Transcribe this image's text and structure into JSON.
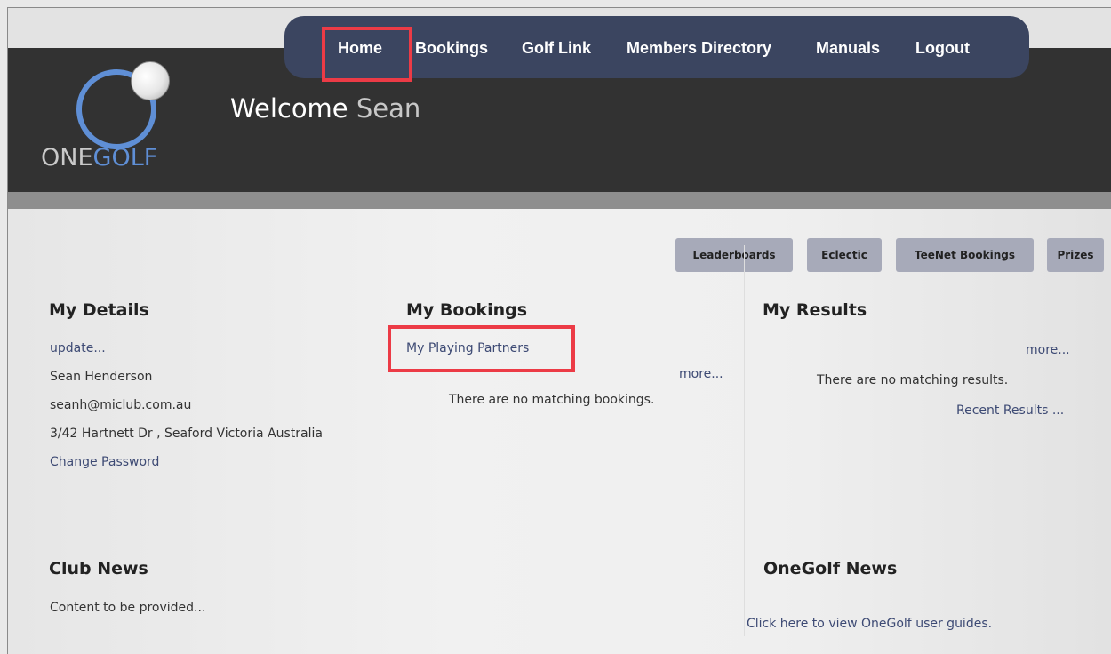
{
  "nav": {
    "items": [
      "Home",
      "Bookings",
      "Golf Link",
      "Members Directory",
      "Manuals",
      "Logout"
    ]
  },
  "logo": {
    "one": "ONE",
    "golf": "GOLF"
  },
  "welcome": {
    "greeting": "Welcome",
    "name": "Sean"
  },
  "action_buttons": [
    "Leaderboards",
    "Eclectic",
    "TeeNet Bookings",
    "Prizes"
  ],
  "my_details": {
    "heading": "My Details",
    "update_link": "update...",
    "name": "Sean Henderson",
    "email": "seanh@miclub.com.au",
    "address": "3/42 Hartnett Dr , Seaford Victoria Australia",
    "change_password": "Change Password"
  },
  "my_bookings": {
    "heading": "My Bookings",
    "playing_partners": "My Playing Partners",
    "more": "more...",
    "empty": "There are no matching bookings."
  },
  "my_results": {
    "heading": "My Results",
    "more": "more...",
    "empty": "There are no matching results.",
    "recent": "Recent Results ..."
  },
  "club_news": {
    "heading": "Club News",
    "content": "Content to be provided..."
  },
  "onegolf_news": {
    "heading": "OneGolf News",
    "guides": "Click here to view OneGolf user guides."
  },
  "colors": {
    "header": "#323232",
    "nav": "#3b4560",
    "highlight": "#ec3b46",
    "logo_blue": "#5f8fd6",
    "pill": "#a7aab9",
    "link": "#3d4a74"
  }
}
